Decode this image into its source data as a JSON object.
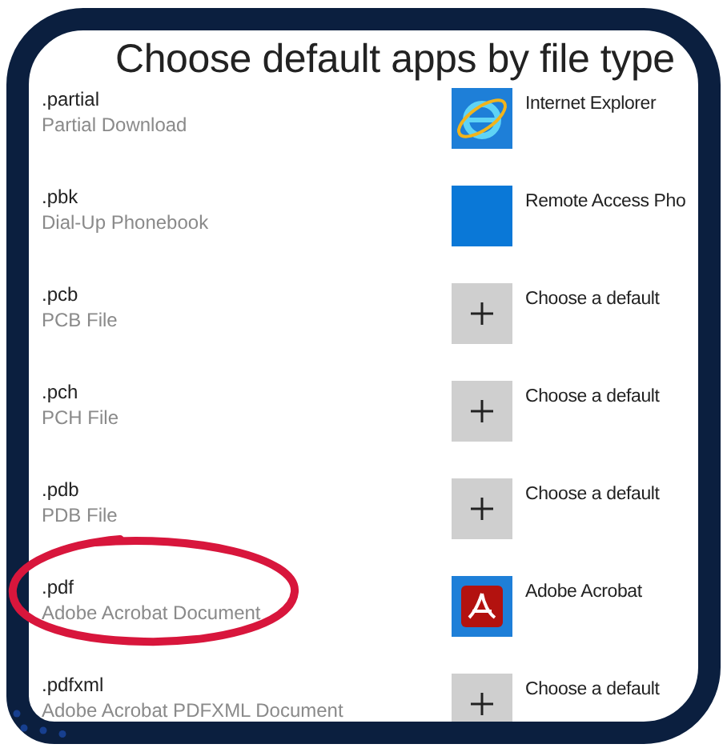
{
  "page": {
    "title": "Choose default apps by file type"
  },
  "rows": [
    {
      "extension": ".partial",
      "description": "Partial Download",
      "app": {
        "kind": "ie",
        "label": "Internet Explorer"
      }
    },
    {
      "extension": ".pbk",
      "description": "Dial-Up Phonebook",
      "app": {
        "kind": "blank",
        "label": "Remote Access Pho"
      }
    },
    {
      "extension": ".pcb",
      "description": "PCB File",
      "app": {
        "kind": "plus",
        "label": "Choose a default"
      }
    },
    {
      "extension": ".pch",
      "description": "PCH File",
      "app": {
        "kind": "plus",
        "label": "Choose a default"
      }
    },
    {
      "extension": ".pdb",
      "description": "PDB File",
      "app": {
        "kind": "plus",
        "label": "Choose a default"
      }
    },
    {
      "extension": ".pdf",
      "description": "Adobe Acrobat Document",
      "app": {
        "kind": "acrobat",
        "label": "Adobe Acrobat"
      }
    },
    {
      "extension": ".pdfxml",
      "description": "Adobe Acrobat PDFXML Document",
      "app": {
        "kind": "plus",
        "label": "Choose a default"
      }
    }
  ]
}
